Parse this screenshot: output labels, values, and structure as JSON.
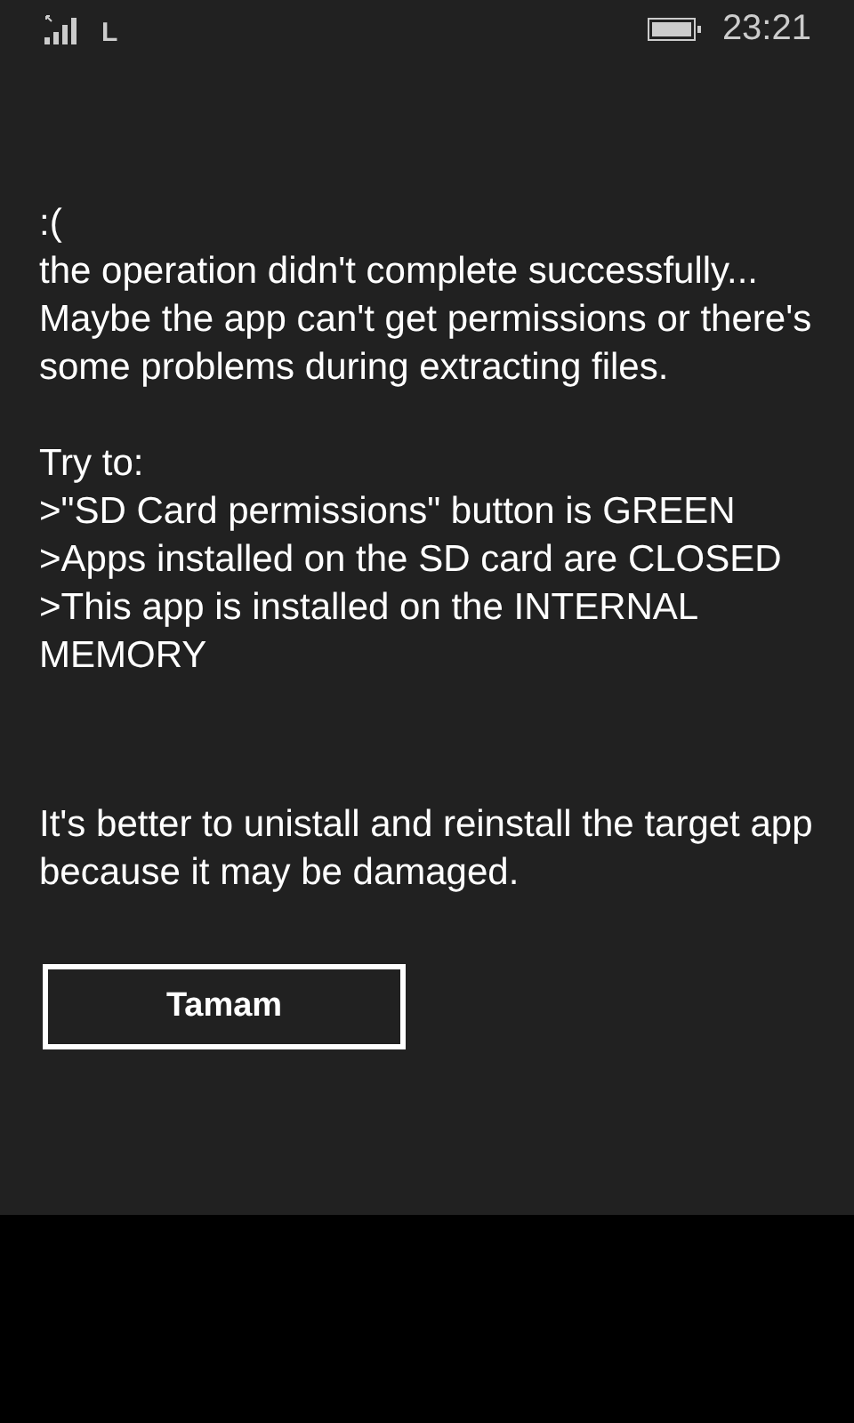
{
  "status_bar": {
    "network": "L",
    "time": "23:21"
  },
  "message": {
    "paragraphs": [
      {
        "lines": [
          ":(",
          "the operation didn't complete successfully...",
          "Maybe the app can't get permissions or there's some problems during extracting files."
        ]
      },
      {
        "lines": [
          "Try to:",
          ">\"SD Card permissions\" button is GREEN",
          ">Apps installed on the SD card are CLOSED",
          ">This app is installed on the INTERNAL MEMORY"
        ]
      },
      {
        "lines": [
          "It's better to unistall and reinstall the target app because it may be damaged."
        ]
      }
    ]
  },
  "buttons": [
    "Tamam"
  ]
}
